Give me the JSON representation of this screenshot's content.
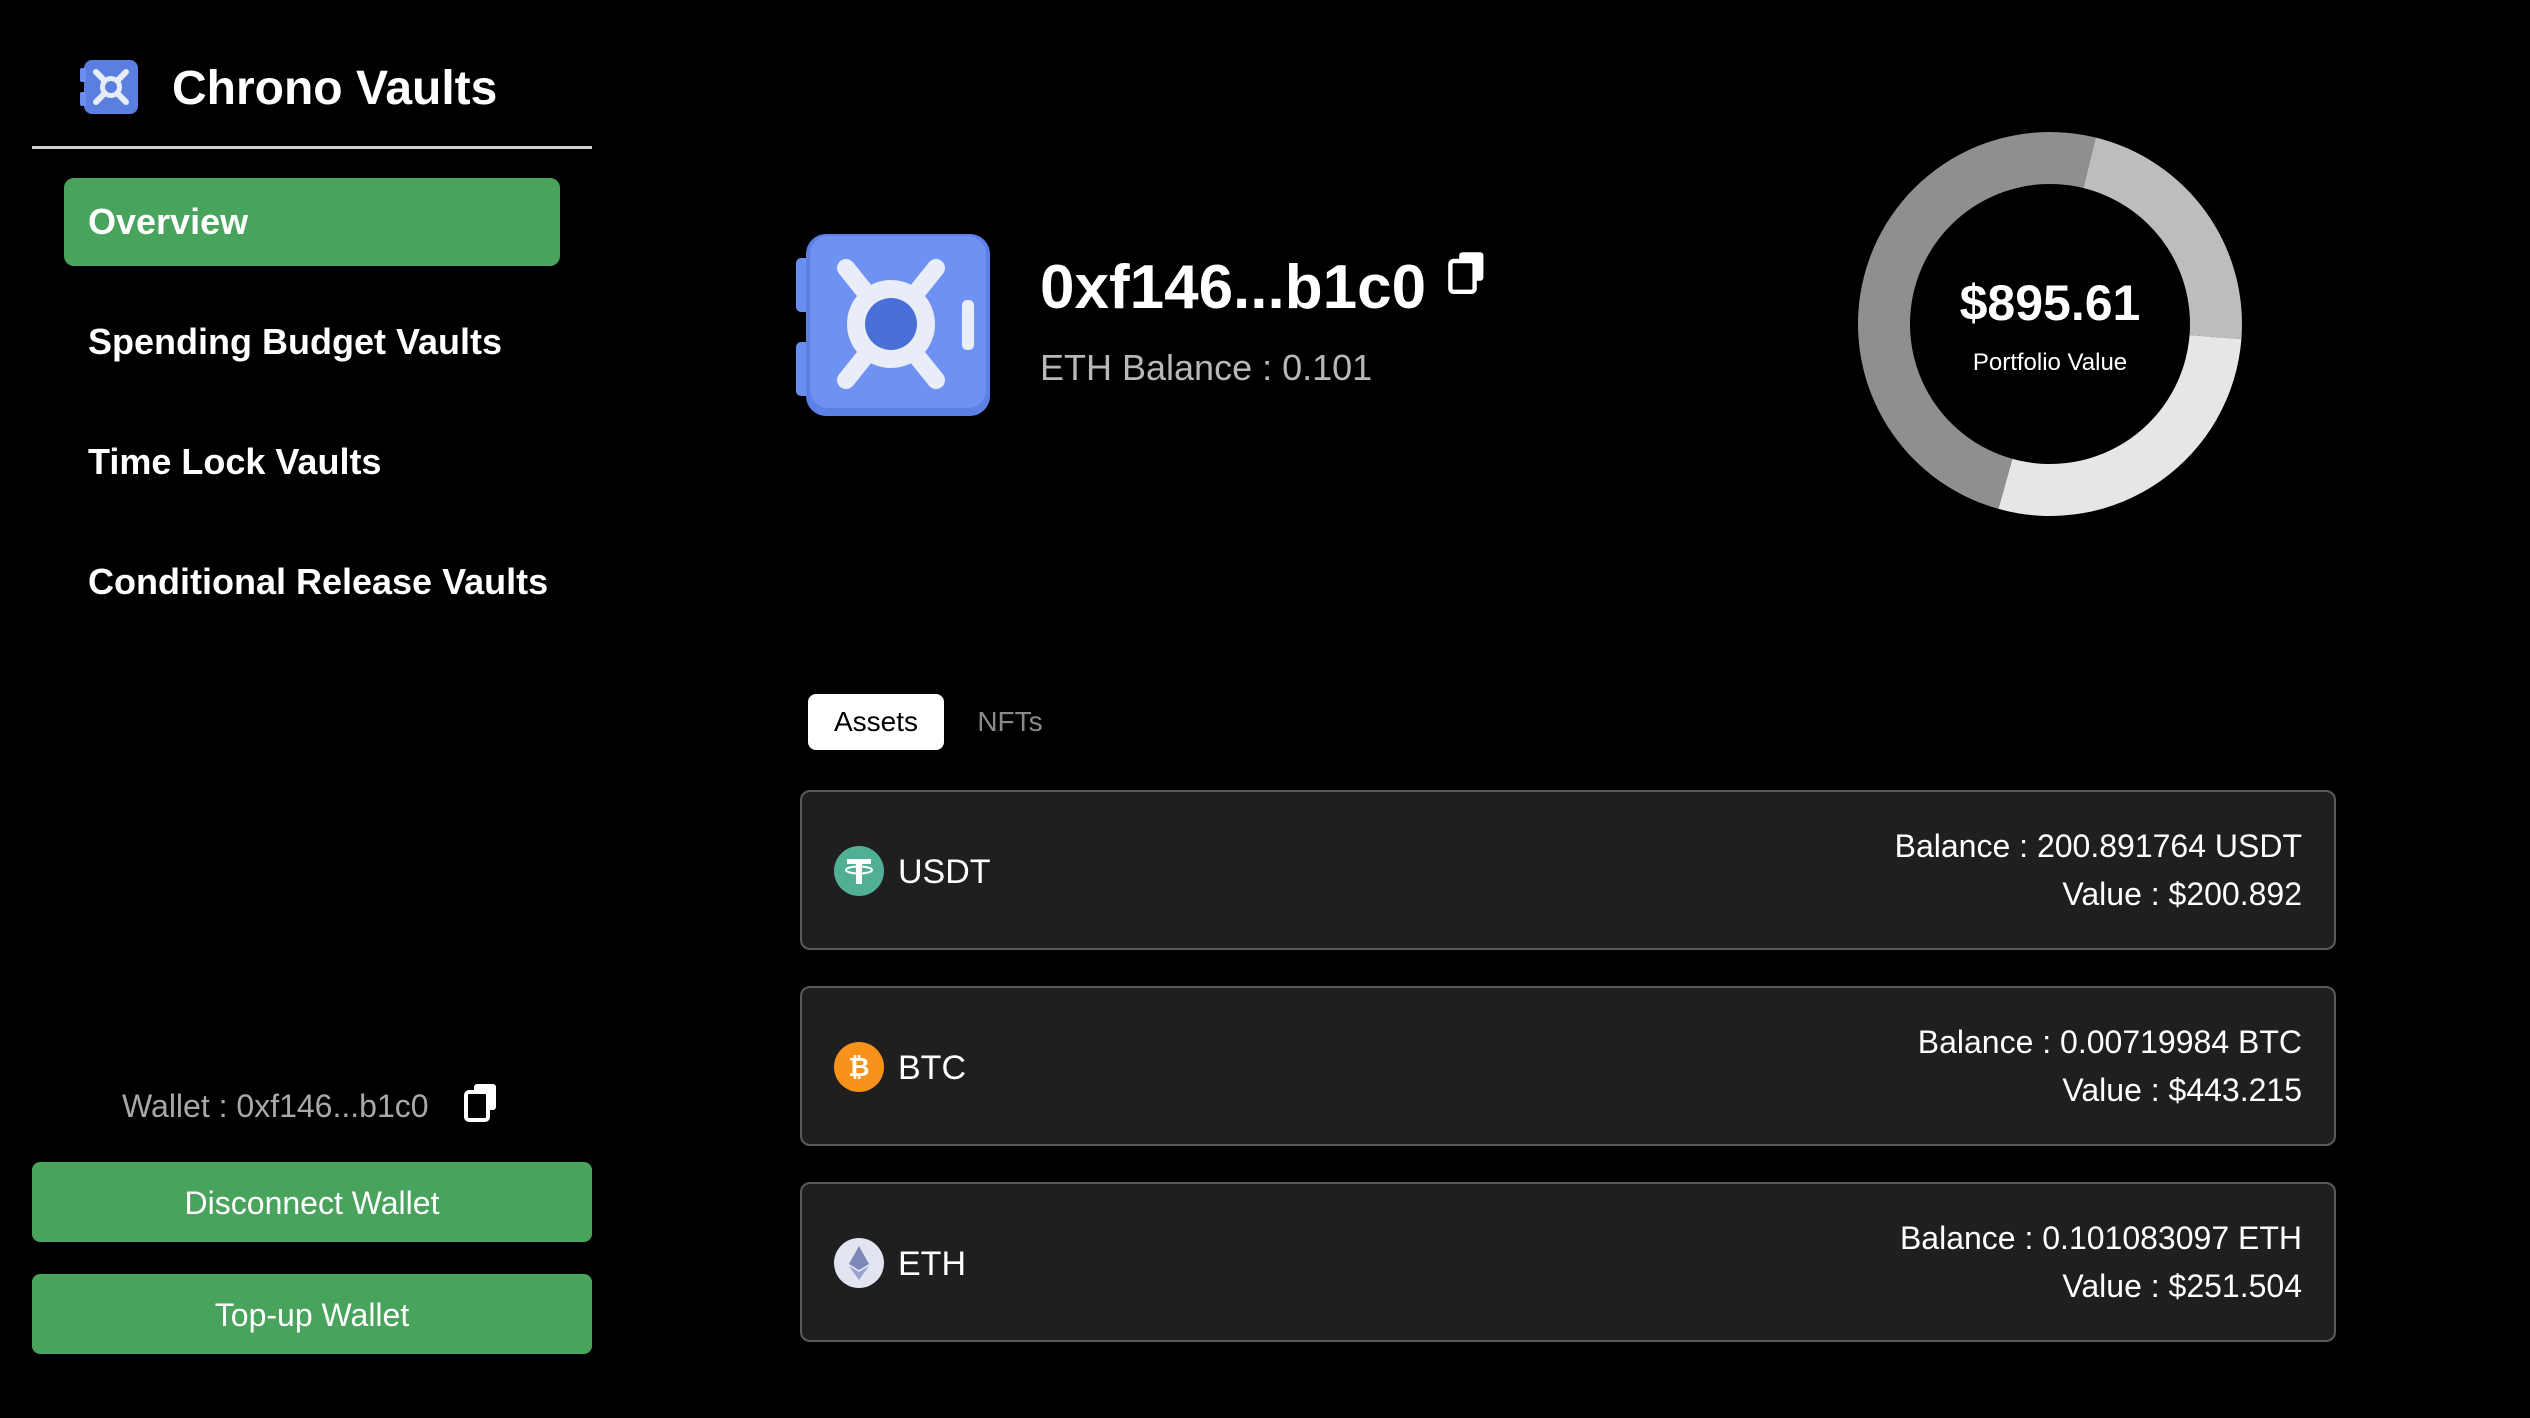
{
  "app": {
    "name": "Chrono Vaults",
    "logo_icon": "vault-icon",
    "accent_color": "#48a35d"
  },
  "sidebar": {
    "items": [
      {
        "label": "Overview",
        "active": true
      },
      {
        "label": "Spending Budget Vaults",
        "active": false
      },
      {
        "label": "Time Lock Vaults",
        "active": false
      },
      {
        "label": "Conditional Release Vaults",
        "active": false
      }
    ],
    "wallet_label": "Wallet : 0xf146...b1c0",
    "copy_icon": "copy-icon",
    "disconnect_label": "Disconnect Wallet",
    "topup_label": "Top-up Wallet"
  },
  "header": {
    "address": "0xf146...b1c0",
    "eth_balance": "ETH Balance : 0.101",
    "copy_icon": "copy-icon"
  },
  "portfolio": {
    "value": "$895.61",
    "label": "Portfolio Value",
    "segments": [
      {
        "asset": "USDT",
        "value": 200.892,
        "color": "#bdbdbd"
      },
      {
        "asset": "ETH",
        "value": 251.504,
        "color": "#e6e6e6"
      },
      {
        "asset": "BTC",
        "value": 443.215,
        "color": "#8f8f8f"
      }
    ]
  },
  "tabs": [
    {
      "label": "Assets",
      "active": true
    },
    {
      "label": "NFTs",
      "active": false
    }
  ],
  "assets": [
    {
      "symbol": "USDT",
      "icon": "tether-icon",
      "icon_color": "#50af95",
      "balance": "Balance : 200.891764 USDT",
      "value": "Value : $200.892"
    },
    {
      "symbol": "BTC",
      "icon": "bitcoin-icon",
      "icon_color": "#f7931a",
      "balance": "Balance : 0.00719984 BTC",
      "value": "Value : $443.215"
    },
    {
      "symbol": "ETH",
      "icon": "ethereum-icon",
      "icon_color": "#e2e5f0",
      "balance": "Balance : 0.101083097 ETH",
      "value": "Value : $251.504"
    }
  ]
}
